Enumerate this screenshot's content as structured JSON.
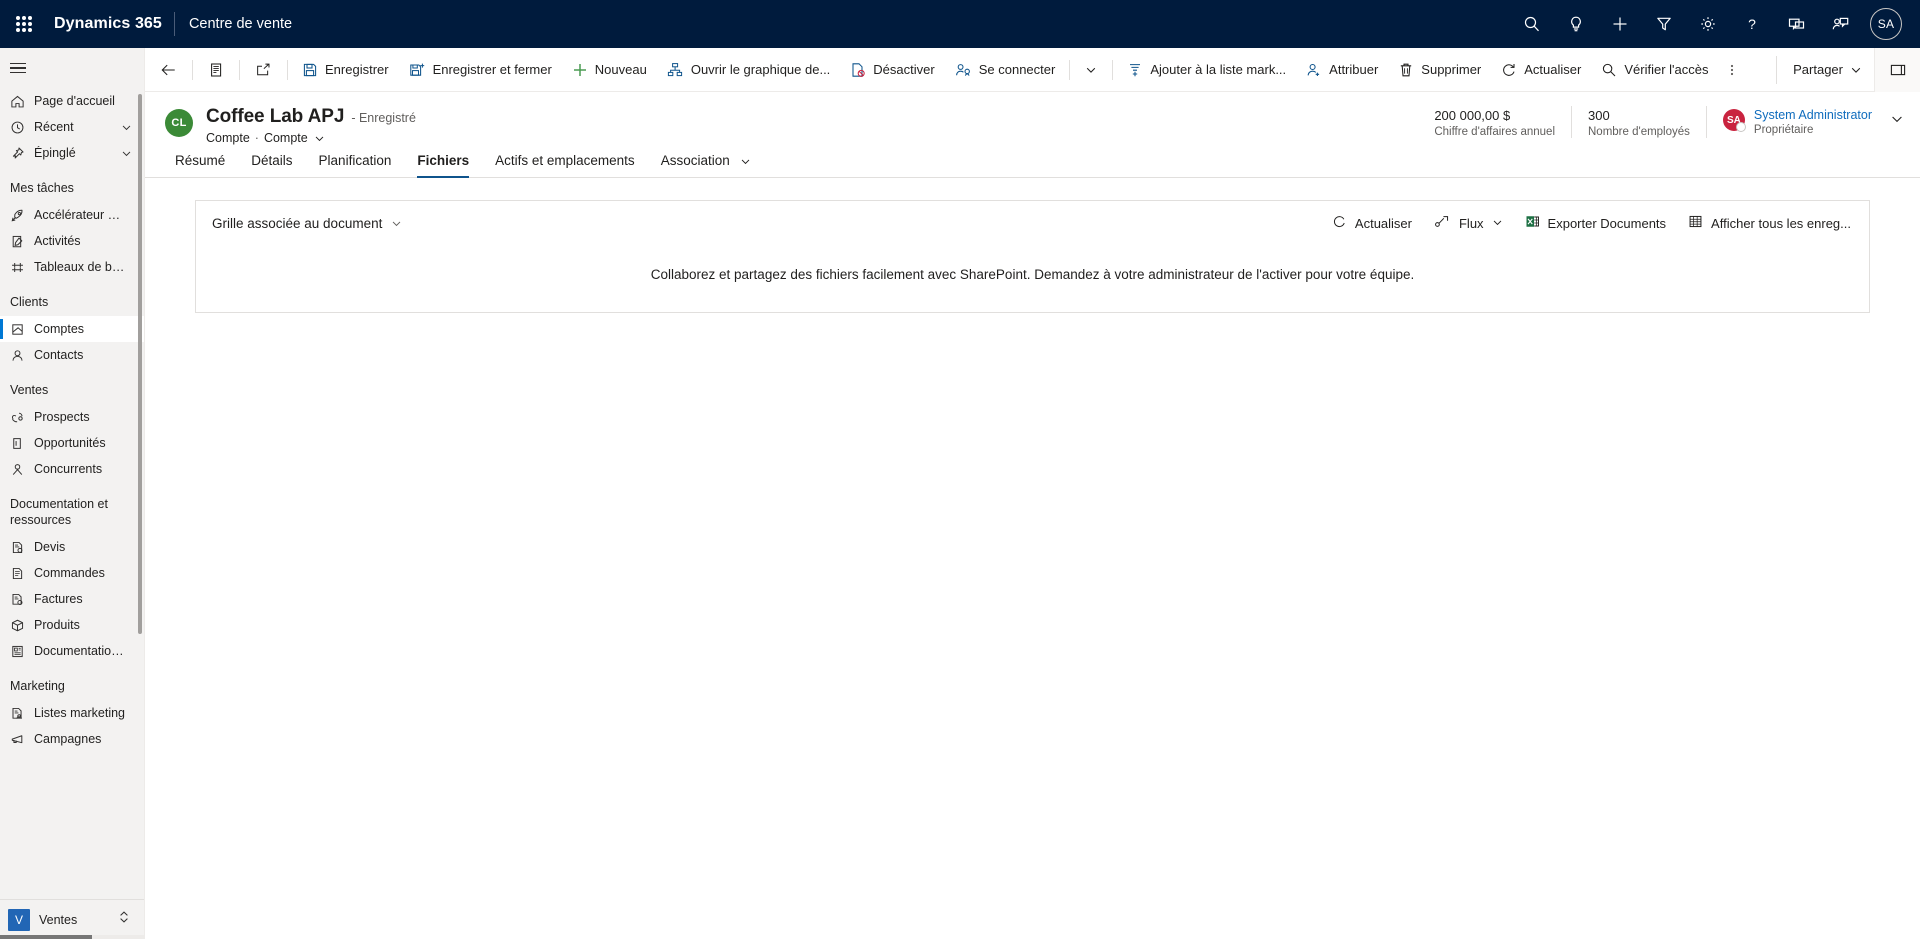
{
  "topnav": {
    "waffle_label": "waffle",
    "brand": "Dynamics 365",
    "app_name": "Centre de vente",
    "icons": [
      {
        "name": "search-icon",
        "label": "Recherche"
      },
      {
        "name": "lightbulb-icon",
        "label": "Assistant"
      },
      {
        "name": "plus-icon",
        "label": "Nouveau"
      },
      {
        "name": "filter-icon",
        "label": "Filtre"
      },
      {
        "name": "gear-icon",
        "label": "Paramètres"
      },
      {
        "name": "help-icon",
        "label": "Aide"
      },
      {
        "name": "feedback-icon",
        "label": "Commentaires"
      },
      {
        "name": "user-feedback-icon",
        "label": "Envoyer un commentaire"
      }
    ],
    "avatar_initials": "SA"
  },
  "commandbar": {
    "back_label": "Précédent",
    "form_icon_label": "Formulaire",
    "popout_label": "Ouvrir dans une nouvelle fenêtre",
    "buttons": [
      {
        "icon": "save-icon",
        "label": "Enregistrer"
      },
      {
        "icon": "save-close-icon",
        "label": "Enregistrer et fermer"
      },
      {
        "icon": "plus-icon",
        "label": "Nouveau"
      },
      {
        "icon": "org-chart-icon",
        "label": "Ouvrir le graphique de..."
      },
      {
        "icon": "deactivate-icon",
        "label": "Désactiver"
      },
      {
        "icon": "connect-icon",
        "label": "Se connecter"
      }
    ],
    "connect_chevron": "chevron-down-icon",
    "buttons2": [
      {
        "icon": "add-to-list-icon",
        "label": "Ajouter à la liste mark..."
      },
      {
        "icon": "assign-icon",
        "label": "Attribuer"
      },
      {
        "icon": "delete-icon",
        "label": "Supprimer"
      },
      {
        "icon": "refresh-icon",
        "label": "Actualiser"
      },
      {
        "icon": "check-access-icon",
        "label": "Vérifier l'accès"
      }
    ],
    "overflow_label": "Plus de commandes",
    "share_label": "Partager",
    "far_icon": "collapse-panel-icon"
  },
  "record": {
    "avatar_initials": "CL",
    "title": "Coffee Lab APJ",
    "status": "- Enregistré",
    "entity": "Compte",
    "form_name": "Compte",
    "header_fields": [
      {
        "value": "200 000,00 $",
        "label": "Chiffre d'affaires annuel"
      },
      {
        "value": "300",
        "label": "Nombre d'employés"
      }
    ],
    "owner": {
      "initials": "SA",
      "name": "System Administrator",
      "role": "Propriétaire"
    }
  },
  "tabs": [
    {
      "label": "Résumé",
      "active": false,
      "chevron": false
    },
    {
      "label": "Détails",
      "active": false,
      "chevron": false
    },
    {
      "label": "Planification",
      "active": false,
      "chevron": false
    },
    {
      "label": "Fichiers",
      "active": true,
      "chevron": false
    },
    {
      "label": "Actifs et emplacements",
      "active": false,
      "chevron": false
    },
    {
      "label": "Association",
      "active": false,
      "chevron": true
    }
  ],
  "documents_panel": {
    "title": "Grille associée au document",
    "actions": [
      {
        "icon": "refresh-icon",
        "label": "Actualiser"
      },
      {
        "icon": "flow-icon",
        "label": "Flux",
        "chevron": true
      },
      {
        "icon": "excel-icon",
        "label": "Exporter Documents"
      },
      {
        "icon": "grid-icon",
        "label": "Afficher tous les enreg..."
      }
    ],
    "empty_message": "Collaborez et partagez des fichiers facilement avec SharePoint. Demandez à votre administrateur de l'activer pour votre équipe."
  },
  "sidebar": {
    "hamburger_label": "Menu",
    "sections": [
      {
        "title": null,
        "items": [
          {
            "icon": "home-icon",
            "label": "Page d'accueil",
            "chevron": false,
            "selected": false
          },
          {
            "icon": "clock-icon",
            "label": "Récent",
            "chevron": true,
            "selected": false
          },
          {
            "icon": "pin-icon",
            "label": "Épinglé",
            "chevron": true,
            "selected": false
          }
        ]
      },
      {
        "title": "Mes tâches",
        "items": [
          {
            "icon": "rocket-icon",
            "label": "Accélérateur des v...",
            "chevron": false,
            "selected": false
          },
          {
            "icon": "activity-icon",
            "label": "Activités",
            "chevron": false,
            "selected": false
          },
          {
            "icon": "dashboard-icon",
            "label": "Tableaux de bord",
            "chevron": false,
            "selected": false
          }
        ]
      },
      {
        "title": "Clients",
        "items": [
          {
            "icon": "account-icon",
            "label": "Comptes",
            "chevron": false,
            "selected": true
          },
          {
            "icon": "contact-icon",
            "label": "Contacts",
            "chevron": false,
            "selected": false
          }
        ]
      },
      {
        "title": "Ventes",
        "items": [
          {
            "icon": "lead-icon",
            "label": "Prospects",
            "chevron": false,
            "selected": false
          },
          {
            "icon": "opportunity-icon",
            "label": "Opportunités",
            "chevron": false,
            "selected": false
          },
          {
            "icon": "competitor-icon",
            "label": "Concurrents",
            "chevron": false,
            "selected": false
          }
        ]
      },
      {
        "title": "Documentation et ressources",
        "items": [
          {
            "icon": "quote-icon",
            "label": "Devis",
            "chevron": false,
            "selected": false
          },
          {
            "icon": "order-icon",
            "label": "Commandes",
            "chevron": false,
            "selected": false
          },
          {
            "icon": "invoice-icon",
            "label": "Factures",
            "chevron": false,
            "selected": false
          },
          {
            "icon": "product-icon",
            "label": "Produits",
            "chevron": false,
            "selected": false
          },
          {
            "icon": "salesdoc-icon",
            "label": "Documentation c...",
            "chevron": false,
            "selected": false
          }
        ]
      },
      {
        "title": "Marketing",
        "items": [
          {
            "icon": "marketing-list-icon",
            "label": "Listes marketing",
            "chevron": false,
            "selected": false
          },
          {
            "icon": "campaign-icon",
            "label": "Campagnes",
            "chevron": false,
            "selected": false
          }
        ]
      }
    ],
    "area_switcher": {
      "initial": "V",
      "label": "Ventes"
    }
  },
  "colors": {
    "topnav_bg": "#001b3d",
    "sidebar_bg": "#f3f2f1",
    "accent": "#0078d4",
    "tab_underline": "#0f548c",
    "record_avatar": "#3b8a37",
    "owner_avatar": "#c9233f",
    "link": "#0f6cbd",
    "area_switcher": "#2266b5"
  }
}
